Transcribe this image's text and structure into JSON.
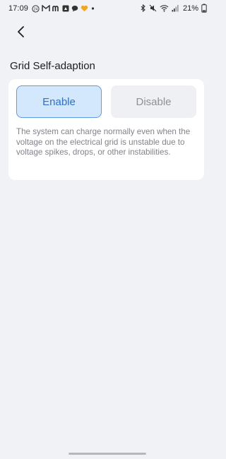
{
  "status_bar": {
    "time": "17:09",
    "battery_percent": "21%",
    "left_icons": [
      "badge-24-icon",
      "mail-icon",
      "m-icon",
      "square-app-icon",
      "chat-bubble-icon",
      "heart-icon",
      "dot-icon"
    ],
    "right_icons": [
      "bluetooth-icon",
      "mute-icon",
      "wifi-icon",
      "signal-icon",
      "battery-icon"
    ]
  },
  "header": {
    "back_icon": "chevron-left-icon"
  },
  "section": {
    "title": "Grid Self-adaption"
  },
  "options": {
    "enable_label": "Enable",
    "disable_label": "Disable",
    "selected": "Enable"
  },
  "description": "The system can charge normally even when the voltage on the electrical grid is unstable due to voltage spikes, drops, or other instabilities.",
  "colors": {
    "background": "#f1f2f6",
    "card": "#ffffff",
    "selected_fill": "#d3e7fd",
    "selected_border": "#5f9be8",
    "selected_text": "#2f6fcd",
    "unselected_fill": "#eff0f3",
    "unselected_text": "#8d9096"
  }
}
